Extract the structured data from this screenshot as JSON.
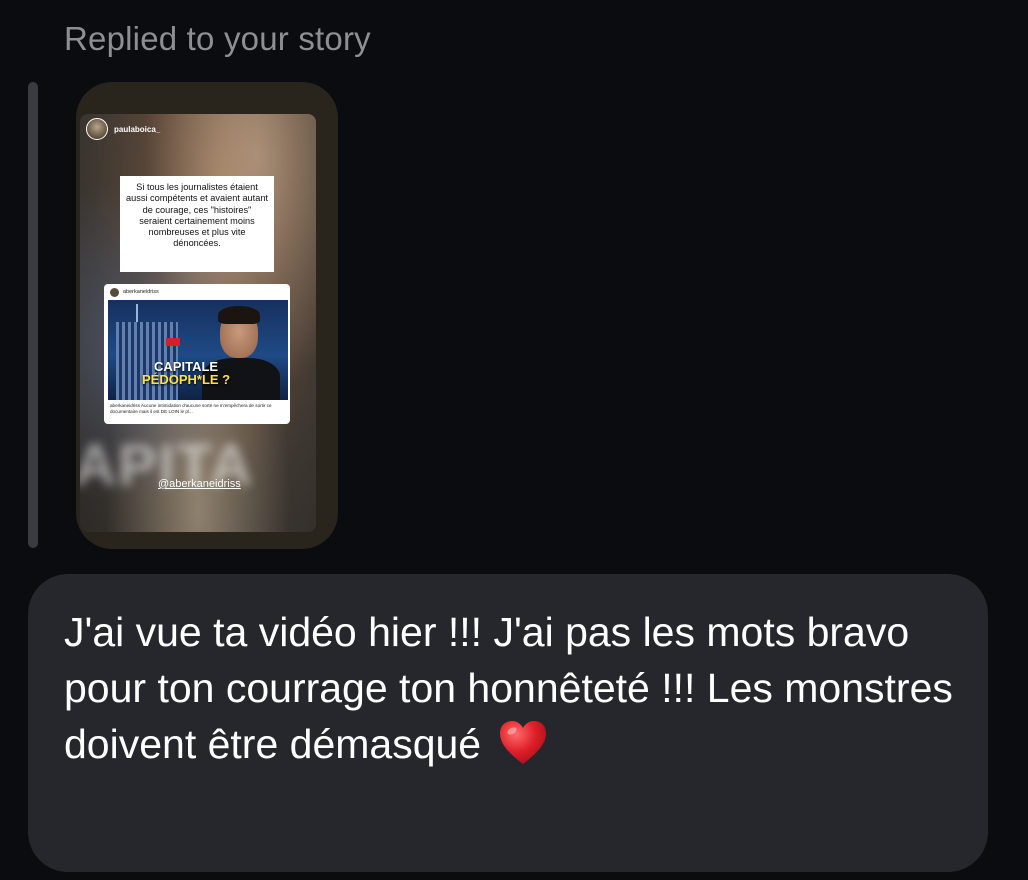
{
  "reply": {
    "caption": "Replied to your story"
  },
  "story": {
    "username": "paulaboica_",
    "quote": "Si tous les journalistes étaient aussi compétents et avaient autant de courage, ces \"histoires\" seraient certainement moins nombreuses et plus vite dénoncées.",
    "post": {
      "username": "aberkaneidriss",
      "title_line1": "CAPITALE",
      "title_line2": "PÉDOPH*LE ?",
      "caption": "aberkaneidriss Aucune intimidation d'aucune sorte ne m'empêchera de sortir ce documentaire mais il est DE LOIN le pl..."
    },
    "mention": "@aberkaneidriss"
  },
  "message": {
    "text": "J'ai vue ta vidéo hier !!! J'ai pas les mots bravo pour ton courrage ton honnêteté !!! Les monstres doivent être démasqué",
    "emoji": "heart-icon",
    "heart_color": "#e0202a"
  },
  "colors": {
    "background": "#0b0c10",
    "bubble": "#25272c",
    "caption": "#8e8e93"
  }
}
